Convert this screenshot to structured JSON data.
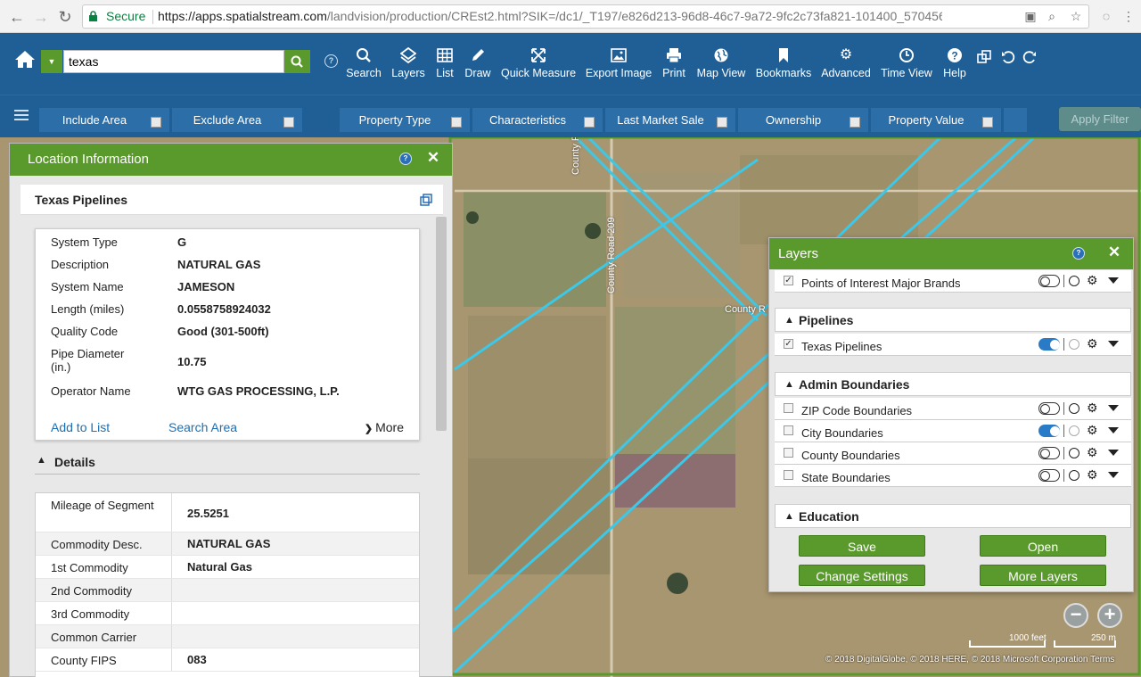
{
  "browser": {
    "secure_label": "Secure",
    "url_host": "https://apps.spatialstream.com",
    "url_path": "/landvision/production/CREst2.html?SIK=/dc1/_T197/e826d213-96d8-46c7-9a72-9fc2c73fa821-101400_57045687..."
  },
  "search": {
    "value": "texas"
  },
  "toolbar": [
    {
      "label": "Search",
      "icon": "search-icon"
    },
    {
      "label": "Layers",
      "icon": "layers-icon"
    },
    {
      "label": "List",
      "icon": "list-icon"
    },
    {
      "label": "Draw",
      "icon": "pencil-icon"
    },
    {
      "label": "Quick Measure",
      "icon": "measure-icon"
    },
    {
      "label": "Export Image",
      "icon": "image-icon"
    },
    {
      "label": "Print",
      "icon": "print-icon"
    },
    {
      "label": "Map View",
      "icon": "globe-icon"
    },
    {
      "label": "Bookmarks",
      "icon": "bookmark-icon"
    },
    {
      "label": "Advanced",
      "icon": "gear-icon"
    },
    {
      "label": "Time View",
      "icon": "clock-icon"
    },
    {
      "label": "Help",
      "icon": "help-icon"
    }
  ],
  "filters": {
    "items": [
      "Include Area",
      "Exclude Area",
      "Property Type",
      "Characteristics",
      "Last Market Sale",
      "Ownership",
      "Property Value"
    ],
    "apply_label": "Apply Filter"
  },
  "location_panel": {
    "title": "Location Information",
    "section_title": "Texas Pipelines",
    "info": [
      {
        "label": "System Type",
        "value": "G"
      },
      {
        "label": "Description",
        "value": "NATURAL GAS"
      },
      {
        "label": "System Name",
        "value": "JAMESON"
      },
      {
        "label": "Length (miles)",
        "value": "0.0558758924032"
      },
      {
        "label": "Quality Code",
        "value": "Good (301-500ft)"
      },
      {
        "label": "Pipe Diameter (in.)",
        "value": "10.75"
      },
      {
        "label": "Operator Name",
        "value": "WTG GAS PROCESSING, L.P."
      }
    ],
    "actions": {
      "add": "Add to List",
      "search": "Search Area",
      "more": "More"
    },
    "details_title": "Details",
    "details": [
      {
        "label": "Mileage of Segment",
        "value": "25.5251"
      },
      {
        "label": "Commodity Desc.",
        "value": "NATURAL GAS"
      },
      {
        "label": "1st Commodity",
        "value": "Natural Gas"
      },
      {
        "label": "2nd Commodity",
        "value": ""
      },
      {
        "label": "3rd Commodity",
        "value": ""
      },
      {
        "label": "Common Carrier",
        "value": ""
      },
      {
        "label": "County FIPS",
        "value": "083"
      }
    ]
  },
  "layers_panel": {
    "title": "Layers",
    "top_row": {
      "name": "Points of Interest Major Brands",
      "checked": true,
      "toggle": false
    },
    "groups": [
      {
        "title": "Pipelines",
        "rows": [
          {
            "name": "Texas Pipelines",
            "checked": true,
            "toggle": true
          }
        ]
      },
      {
        "title": "Admin Boundaries",
        "rows": [
          {
            "name": "ZIP Code Boundaries",
            "checked": false,
            "toggle": false
          },
          {
            "name": "City Boundaries",
            "checked": false,
            "toggle": true
          },
          {
            "name": "County Boundaries",
            "checked": false,
            "toggle": false
          },
          {
            "name": "State Boundaries",
            "checked": false,
            "toggle": false
          }
        ]
      },
      {
        "title": "Education",
        "rows": []
      }
    ],
    "buttons": {
      "save": "Save",
      "open": "Open",
      "change": "Change Settings",
      "more": "More Layers"
    }
  },
  "map": {
    "road_labels": [
      "County Road",
      "County Road 209",
      "County R"
    ],
    "scale": {
      "feet": "1000 feet",
      "meters": "250 m"
    },
    "attribution": "© 2018 DigitalGlobe, © 2018 HERE, © 2018 Microsoft Corporation  Terms"
  },
  "colors": {
    "brand_blue": "#1f5f96",
    "accent_green": "#5a9a2c",
    "pipeline": "#3cc8e8"
  }
}
